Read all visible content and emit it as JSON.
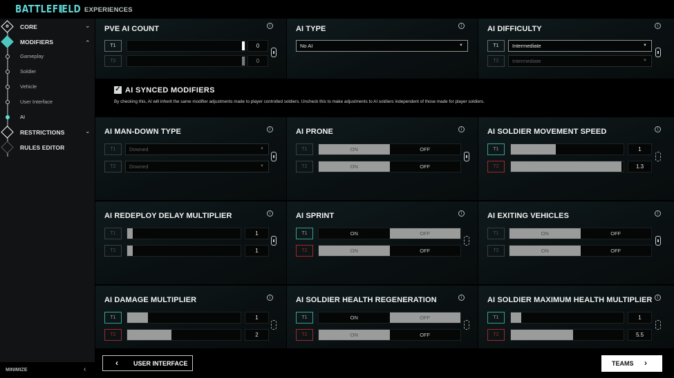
{
  "header": {
    "logo": "BATTLEFIELD",
    "tab": "EXPERIENCES"
  },
  "sidebar": {
    "items": [
      {
        "label": "CORE",
        "type": "section",
        "icon": "gear-icon",
        "expanded": false
      },
      {
        "label": "MODIFIERS",
        "type": "section",
        "icon": "sliders-icon",
        "expanded": true,
        "active": true
      },
      {
        "label": "Gameplay",
        "type": "sub"
      },
      {
        "label": "Soldier",
        "type": "sub"
      },
      {
        "label": "Vehicle",
        "type": "sub"
      },
      {
        "label": "User Interface",
        "type": "sub"
      },
      {
        "label": "AI",
        "type": "sub",
        "active": true
      },
      {
        "label": "RESTRICTIONS",
        "type": "section",
        "icon": "gun-icon",
        "expanded": false
      },
      {
        "label": "RULES EDITOR",
        "type": "section",
        "icon": "tools-icon",
        "disabled": true
      }
    ],
    "minimize": "MINIMIZE"
  },
  "teams": {
    "t1": "T1",
    "t2": "T2"
  },
  "colors": {
    "accent": "#5fd3d3",
    "team1": "#3aa08f",
    "team2": "#a3262c"
  },
  "panels": {
    "pve_ai_count": {
      "title": "PVE AI COUNT",
      "t1": "0",
      "t2": "0",
      "t1_fraction": 1.0,
      "t2_fraction": 1.0
    },
    "ai_type": {
      "title": "AI TYPE",
      "value": "No AI"
    },
    "ai_difficulty": {
      "title": "AI DIFFICULTY",
      "t1": "Intermediate",
      "t2": "Intermediate"
    },
    "ai_man_down_type": {
      "title": "AI MAN-DOWN TYPE",
      "t1": "Downed",
      "t2": "Downed"
    },
    "ai_prone": {
      "title": "AI PRONE",
      "on": "ON",
      "off": "OFF",
      "t1": "ON",
      "t2": "ON"
    },
    "ai_soldier_movement_speed": {
      "title": "AI SOLDIER MOVEMENT SPEED",
      "t1": "1",
      "t2": "1.3",
      "t1_fraction": 0.4,
      "t2_fraction": 0.98
    },
    "ai_redeploy_delay_multiplier": {
      "title": "AI REDEPLOY DELAY MULTIPLIER",
      "t1": "1",
      "t2": "1",
      "t1_fraction": 0.05,
      "t2_fraction": 0.05
    },
    "ai_sprint": {
      "title": "AI SPRINT",
      "on": "ON",
      "off": "OFF",
      "t1": "OFF",
      "t2": "ON"
    },
    "ai_exiting_vehicles": {
      "title": "AI EXITING VEHICLES",
      "on": "ON",
      "off": "OFF",
      "t1": "ON",
      "t2": "ON"
    },
    "ai_damage_multiplier": {
      "title": "AI DAMAGE MULTIPLIER",
      "t1": "1",
      "t2": "2",
      "t1_fraction": 0.18,
      "t2_fraction": 0.39
    },
    "ai_soldier_health_regeneration": {
      "title": "AI SOLDIER HEALTH REGENERATION",
      "on": "ON",
      "off": "OFF",
      "t1": "OFF",
      "t2": "ON"
    },
    "ai_soldier_maximum_health_multiplier": {
      "title": "AI SOLDIER MAXIMUM HEALTH MULTIPLIER",
      "t1": "1",
      "t2": "5.5",
      "t1_fraction": 0.09,
      "t2_fraction": 0.55
    }
  },
  "synced": {
    "checked": true,
    "title": "AI SYNCED MODIFIERS",
    "description": "By checking this, AI will inherit the same modifier adjustments made to player controlled soldiers. Uncheck this to make adjustments to AI soldiers independent of those made for player soldiers."
  },
  "footer": {
    "back_label": "USER INTERFACE",
    "next_label": "TEAMS"
  }
}
